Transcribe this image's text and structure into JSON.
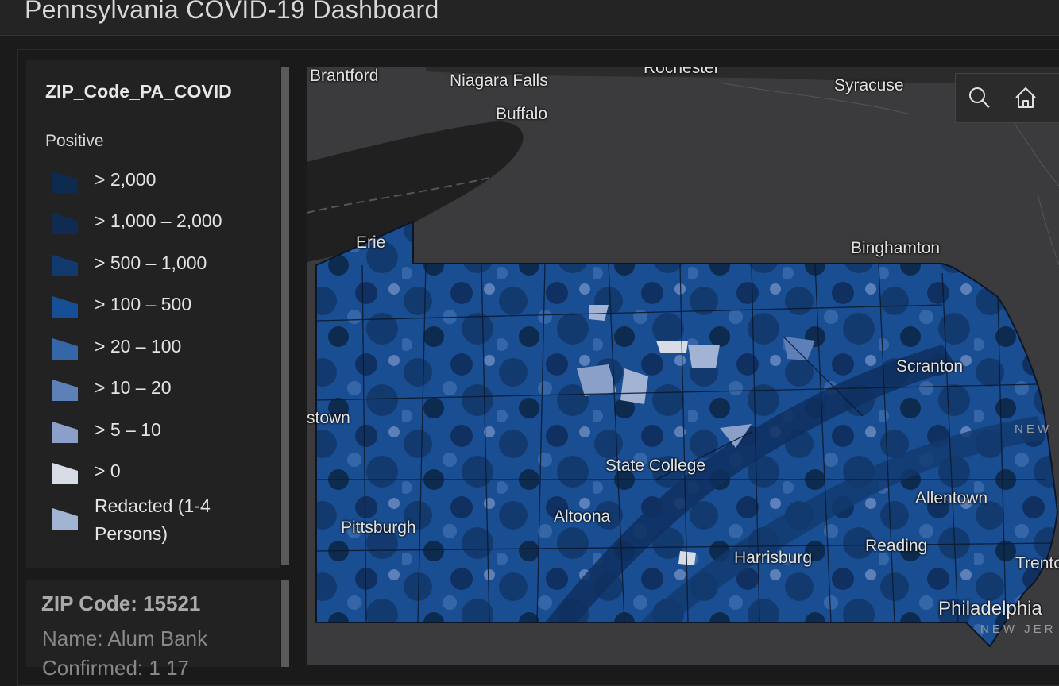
{
  "header": {
    "title": "Pennsylvania COVID-19 Dashboard"
  },
  "legend": {
    "layer_name": "ZIP_Code_PA_COVID",
    "field_name": "Positive",
    "items": [
      {
        "label": "> 2,000",
        "color": "#0d2a4f"
      },
      {
        "label": "> 1,000 – 2,000",
        "color": "#102b52"
      },
      {
        "label": "> 500 – 1,000",
        "color": "#123a6e"
      },
      {
        "label": "> 100 – 500",
        "color": "#154f96"
      },
      {
        "label": "> 20 – 100",
        "color": "#3566a7"
      },
      {
        "label": "> 10 – 20",
        "color": "#5e80b8"
      },
      {
        "label": "> 5 – 10",
        "color": "#8aa0c9"
      },
      {
        "label": "> 0",
        "color": "#d7dce6"
      },
      {
        "label": "Redacted (1-4 Persons)",
        "color": "#a3b3d3"
      }
    ]
  },
  "popup": {
    "title": "ZIP Code: 15521",
    "name_line": "Name: Alum Bank",
    "cut_line": "Confirmed: 1 17"
  },
  "map": {
    "cities": {
      "brantford": "Brantford",
      "niagara_falls": "Niagara Falls",
      "rochester": "Rochester",
      "syracuse": "Syracuse",
      "buffalo": "Buffalo",
      "erie": "Erie",
      "binghamton": "Binghamton",
      "scranton": "Scranton",
      "town": "stown",
      "state_college": "State College",
      "allentown": "Allentown",
      "altoona": "Altoona",
      "pittsburgh": "Pittsburgh",
      "reading": "Reading",
      "harrisburg": "Harrisburg",
      "trenton": "Trento",
      "philadelphia": "Philadelphia"
    },
    "state_labels": {
      "new_a": "NEW",
      "new_b": "NEW JER"
    },
    "tools": [
      {
        "name": "search",
        "icon": "search-icon"
      },
      {
        "name": "home",
        "icon": "home-icon"
      }
    ]
  }
}
